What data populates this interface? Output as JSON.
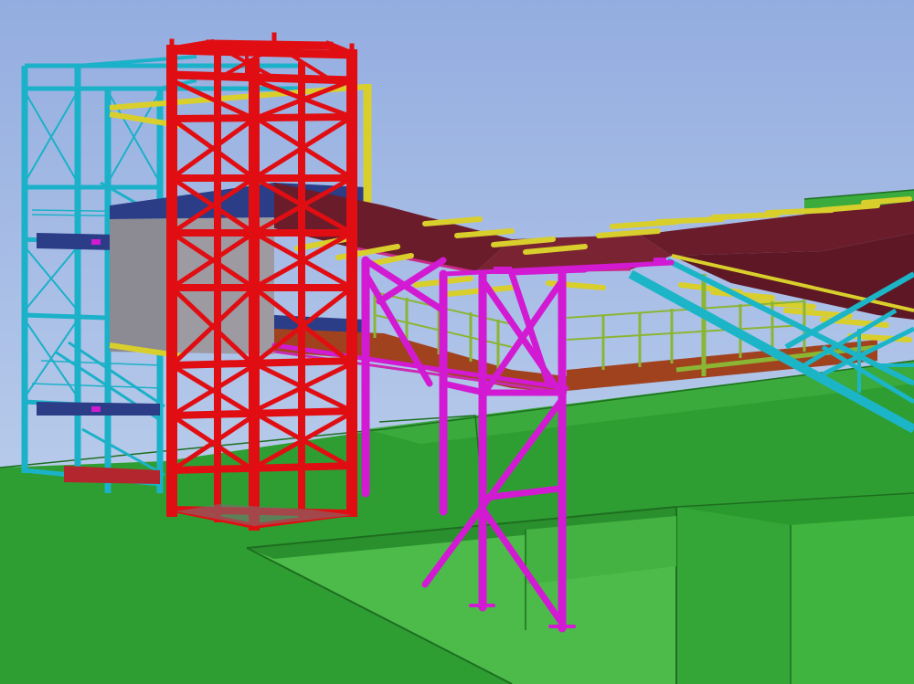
{
  "scene": {
    "type": "3d-steel-structure-model",
    "colors": {
      "sky_top": "#94ade0",
      "sky_bottom": "#c6d7ef",
      "ground": "#2f9e32",
      "ground_light": "#44b244",
      "ground_shade": "#238a27",
      "ground_edge": "#1d6e20",
      "cyan_tower": "#1bb1c8",
      "red_tower": "#e00e12",
      "magenta_support": "#d21ad2",
      "yellow_beam": "#d9cf2c",
      "deck_maroon": "#6b1c2a",
      "deck_brown": "#a1421e",
      "floor_blue": "#2a3d86",
      "cladding_grey": "#9d9aa2",
      "olive_railing": "#8bb534",
      "conveyor_cyan": "#1cb5c8"
    }
  }
}
